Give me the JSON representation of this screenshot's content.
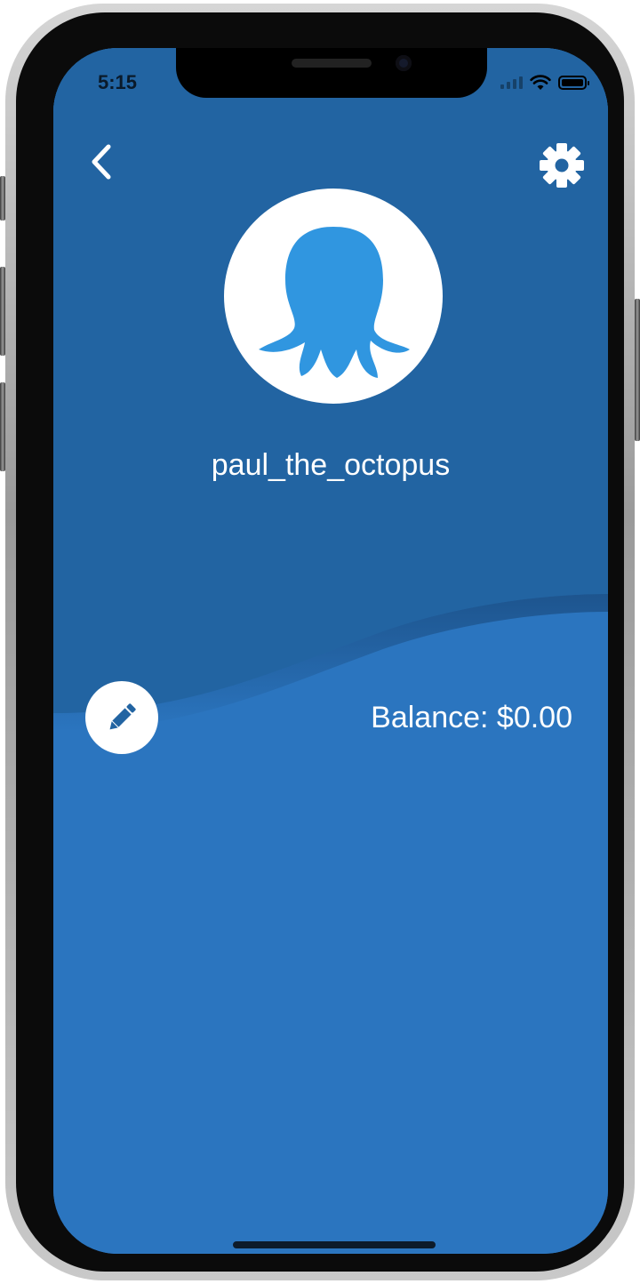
{
  "status_bar": {
    "time": "5:15",
    "icons": [
      "signal-icon",
      "wifi-icon",
      "battery-icon"
    ]
  },
  "header": {
    "back_icon": "chevron-left-icon",
    "settings_icon": "gear-icon"
  },
  "profile": {
    "avatar_icon": "octopus-icon",
    "username": "paul_the_octopus"
  },
  "account": {
    "edit_icon": "pencil-icon",
    "balance_text": "Balance: $0.00"
  },
  "colors": {
    "header_blue": "#2264a2",
    "body_blue": "#2b75bf",
    "octopus_blue": "#3096e0",
    "white": "#ffffff"
  }
}
